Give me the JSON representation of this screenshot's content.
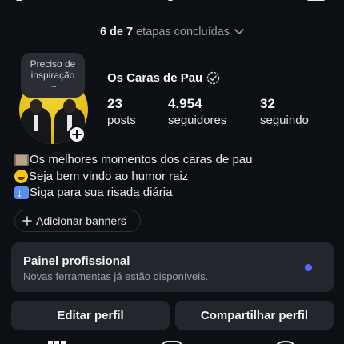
{
  "onboarding": {
    "progress": "6 de 7",
    "progress_suffix": "etapas concluídas",
    "steps_done": 6,
    "steps_total": 7
  },
  "profile": {
    "note_bubble": "Preciso de inspiração",
    "note_ellipsis": "...",
    "display_name": "Os Caras de Pau",
    "verified_icon": "verified-badge-icon"
  },
  "stats": [
    {
      "value": "23",
      "label": "posts"
    },
    {
      "value": "4.954",
      "label": "seguidores"
    },
    {
      "value": "32",
      "label": "seguindo"
    }
  ],
  "bio": [
    {
      "icon": "tv-emoji",
      "text": "Os melhores momentos dos caras de pau"
    },
    {
      "icon": "laughing-emoji",
      "text": "Seja bem vindo ao humor raiz"
    },
    {
      "icon": "down-arrow-emoji",
      "text": "Siga para sua risada diária"
    }
  ],
  "actions": {
    "add_banners": "Adicionar banners",
    "edit_profile": "Editar perfil",
    "share_profile": "Compartilhar perfil"
  },
  "professional_panel": {
    "title": "Painel profissional",
    "subtitle": "Novas ferramentas já estão disponíveis.",
    "indicator_color": "#4f6ef7"
  },
  "colors": {
    "background": "#0c0f14",
    "surface": "#23262c",
    "accent": "#4f6ef7"
  }
}
